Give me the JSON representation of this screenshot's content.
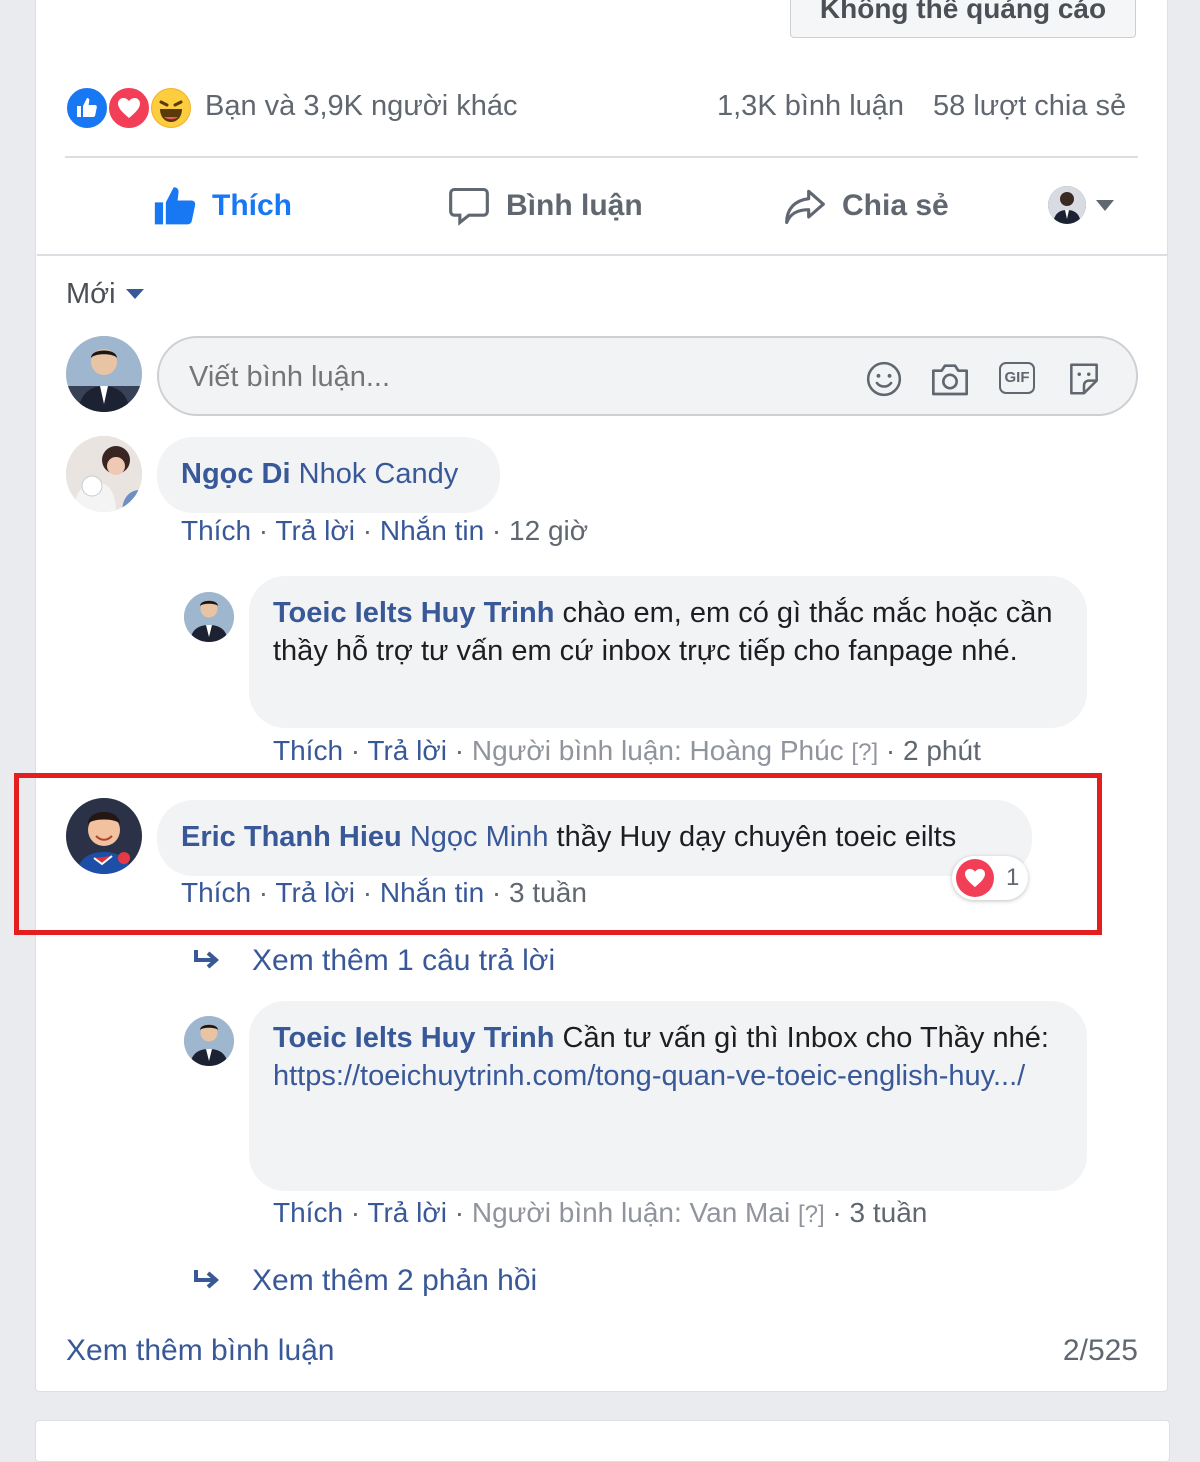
{
  "ad_button_label": "Không thể quảng cáo",
  "summary": {
    "reactions_text": "Bạn và 3,9K người khác",
    "comments_count": "1,3K bình luận",
    "shares_count": "58 lượt chia sẻ",
    "reaction_icons": [
      "like-icon",
      "love-icon",
      "haha-icon"
    ]
  },
  "actions": {
    "like": "Thích",
    "comment": "Bình luận",
    "share": "Chia sẻ"
  },
  "sort_label": "Mới",
  "composer": {
    "placeholder": "Viết bình luận...",
    "icons": [
      "emoji-icon",
      "camera-icon",
      "gif-icon",
      "sticker-icon"
    ],
    "gif_label": "GIF"
  },
  "comments": [
    {
      "author": "Ngọc Di",
      "text": "Nhok Candy",
      "meta": {
        "like": "Thích",
        "reply": "Trả lời",
        "message": "Nhắn tin",
        "time": "12 giờ"
      },
      "reply": {
        "author": "Toeic Ielts Huy Trinh",
        "text": "chào em, em có gì thắc mắc hoặc cần thầy hỗ trợ tư vấn em cứ inbox trực tiếp cho fanpage nhé.",
        "meta": {
          "like": "Thích",
          "reply": "Trả lời",
          "commenter": "Người bình luận: Hoàng Phúc",
          "q": "[?]",
          "time": "2 phút"
        }
      }
    },
    {
      "author": "Eric Thanh Hieu",
      "mention": "Ngọc Minh",
      "text": "thầy Huy dạy chuyên toeic eilts",
      "reaction_count": "1",
      "meta": {
        "like": "Thích",
        "reply": "Trả lời",
        "message": "Nhắn tin",
        "time": "3 tuần"
      },
      "more_replies": "Xem thêm 1 câu trả lời",
      "reply": {
        "author": "Toeic Ielts Huy Trinh",
        "text": "Cần tư vấn gì thì Inbox cho Thầy nhé:",
        "link": "https://toeichuytrinh.com/tong-quan-ve-toeic-english-huy.../",
        "meta": {
          "like": "Thích",
          "reply": "Trả lời",
          "commenter": "Người bình luận: Van Mai",
          "q": "[?]",
          "time": "3 tuần"
        }
      },
      "more_replies_2": "Xem thêm 2 phản hồi"
    }
  ],
  "footer": {
    "more_comments": "Xem thêm bình luận",
    "count": "2/525"
  },
  "colors": {
    "link_blue": "#385898",
    "like_blue": "#1877f2",
    "highlight_red": "#e41e1e"
  }
}
